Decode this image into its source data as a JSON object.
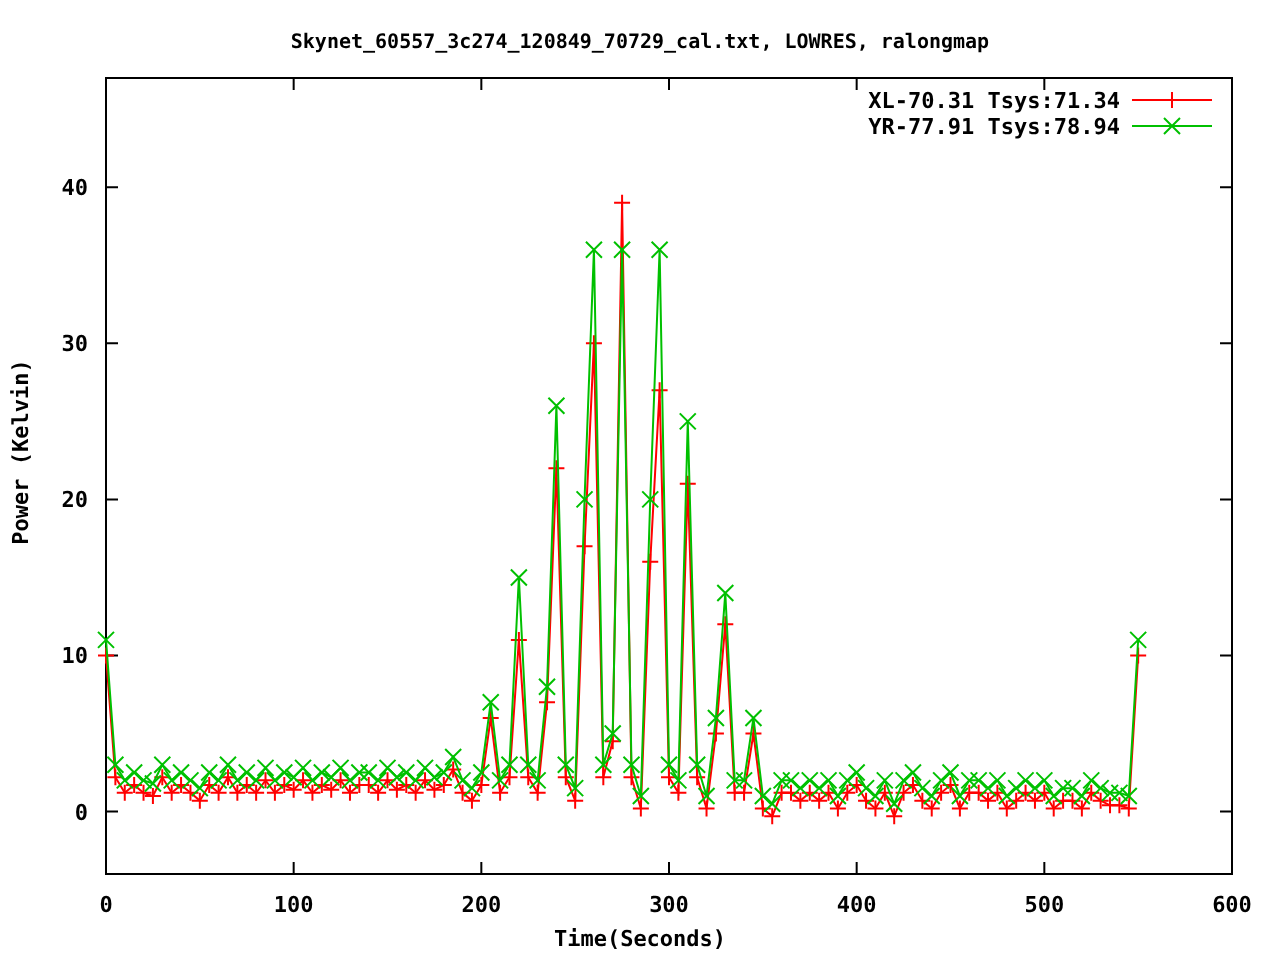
{
  "chart_data": {
    "type": "line",
    "title": "Skynet_60557_3c274_120849_70729_cal.txt, LOWRES, ralongmap",
    "xlabel": "Time(Seconds)",
    "ylabel": "Power (Kelvin)",
    "x": [
      0,
      5,
      10,
      15,
      20,
      25,
      30,
      35,
      40,
      45,
      50,
      55,
      60,
      65,
      70,
      75,
      80,
      85,
      90,
      95,
      100,
      105,
      110,
      115,
      120,
      125,
      130,
      135,
      140,
      145,
      150,
      155,
      160,
      165,
      170,
      175,
      180,
      185,
      190,
      195,
      200,
      205,
      210,
      215,
      220,
      225,
      230,
      235,
      240,
      245,
      250,
      255,
      260,
      265,
      270,
      275,
      280,
      285,
      290,
      295,
      300,
      305,
      310,
      315,
      320,
      325,
      330,
      335,
      340,
      345,
      350,
      355,
      360,
      365,
      370,
      375,
      380,
      385,
      390,
      395,
      400,
      405,
      410,
      415,
      420,
      425,
      430,
      435,
      440,
      445,
      450,
      455,
      460,
      465,
      470,
      475,
      480,
      485,
      490,
      495,
      500,
      505,
      510,
      515,
      520,
      525,
      530,
      535,
      540,
      545,
      550
    ],
    "series": [
      {
        "name": "XL-70.31 Tsys:71.34",
        "color": "#ff0000",
        "marker": "plus",
        "values": [
          10,
          2.2,
          1.2,
          1.7,
          1.2,
          1,
          2.2,
          1.2,
          1.7,
          1.2,
          0.7,
          1.7,
          1.2,
          2.2,
          1.2,
          1.7,
          1.2,
          2,
          1.2,
          1.7,
          1.4,
          2,
          1.2,
          1.7,
          1.4,
          2,
          1.2,
          1.7,
          1.7,
          1.2,
          2,
          1.4,
          1.7,
          1.2,
          2,
          1.4,
          1.7,
          2.7,
          1.2,
          0.7,
          1.7,
          6,
          1.2,
          2.2,
          11,
          2.2,
          1.2,
          7,
          22,
          2.2,
          0.7,
          17,
          30,
          2.2,
          4.5,
          39,
          2.2,
          0.2,
          16,
          27,
          2.2,
          1.2,
          21,
          2.2,
          0.2,
          5,
          12,
          1.2,
          1.2,
          5,
          0.2,
          -0.3,
          1.2,
          1.2,
          0.7,
          1.2,
          0.7,
          1.2,
          0.2,
          1.2,
          1.7,
          0.7,
          0.2,
          1.2,
          -0.3,
          1.2,
          1.7,
          0.7,
          0.2,
          1.2,
          1.7,
          0.2,
          1.2,
          1.2,
          0.7,
          1.2,
          0.2,
          0.7,
          1.2,
          0.7,
          1.2,
          0.2,
          0.7,
          0.7,
          0.2,
          1.2,
          0.7,
          0.4,
          0.4,
          0.2,
          10
        ]
      },
      {
        "name": "YR-77.91 Tsys:78.94",
        "color": "#00c000",
        "marker": "cross",
        "values": [
          11,
          3,
          2,
          2.5,
          2,
          1.8,
          3,
          2,
          2.5,
          2,
          1.5,
          2.5,
          2,
          3,
          2,
          2.5,
          2,
          2.8,
          2,
          2.5,
          2.2,
          2.8,
          2,
          2.5,
          2.2,
          2.8,
          2,
          2.5,
          2.5,
          2,
          2.8,
          2.2,
          2.5,
          2,
          2.8,
          2.2,
          2.5,
          3.5,
          2,
          1.5,
          2.5,
          7,
          2,
          3,
          15,
          3,
          2,
          8,
          26,
          3,
          1.5,
          20,
          36,
          3,
          5,
          36,
          3,
          1,
          20,
          36,
          3,
          2,
          25,
          3,
          1,
          6,
          14,
          2,
          2,
          6,
          1,
          0.5,
          2,
          2,
          1.5,
          2,
          1.5,
          2,
          1,
          2,
          2.5,
          1.5,
          1,
          2,
          0.5,
          2,
          2.5,
          1.5,
          1,
          2,
          2.5,
          1,
          2,
          2,
          1.5,
          2,
          1,
          1.5,
          2,
          1.5,
          2,
          1,
          1.5,
          1.5,
          1,
          2,
          1.5,
          1.2,
          1.2,
          1,
          11
        ]
      }
    ],
    "legend": true,
    "xlim": [
      0,
      600
    ],
    "ylim": [
      -4,
      47
    ],
    "xticks": [
      0,
      100,
      200,
      300,
      400,
      500,
      600
    ],
    "yticks": [
      0,
      10,
      20,
      30,
      40
    ]
  }
}
